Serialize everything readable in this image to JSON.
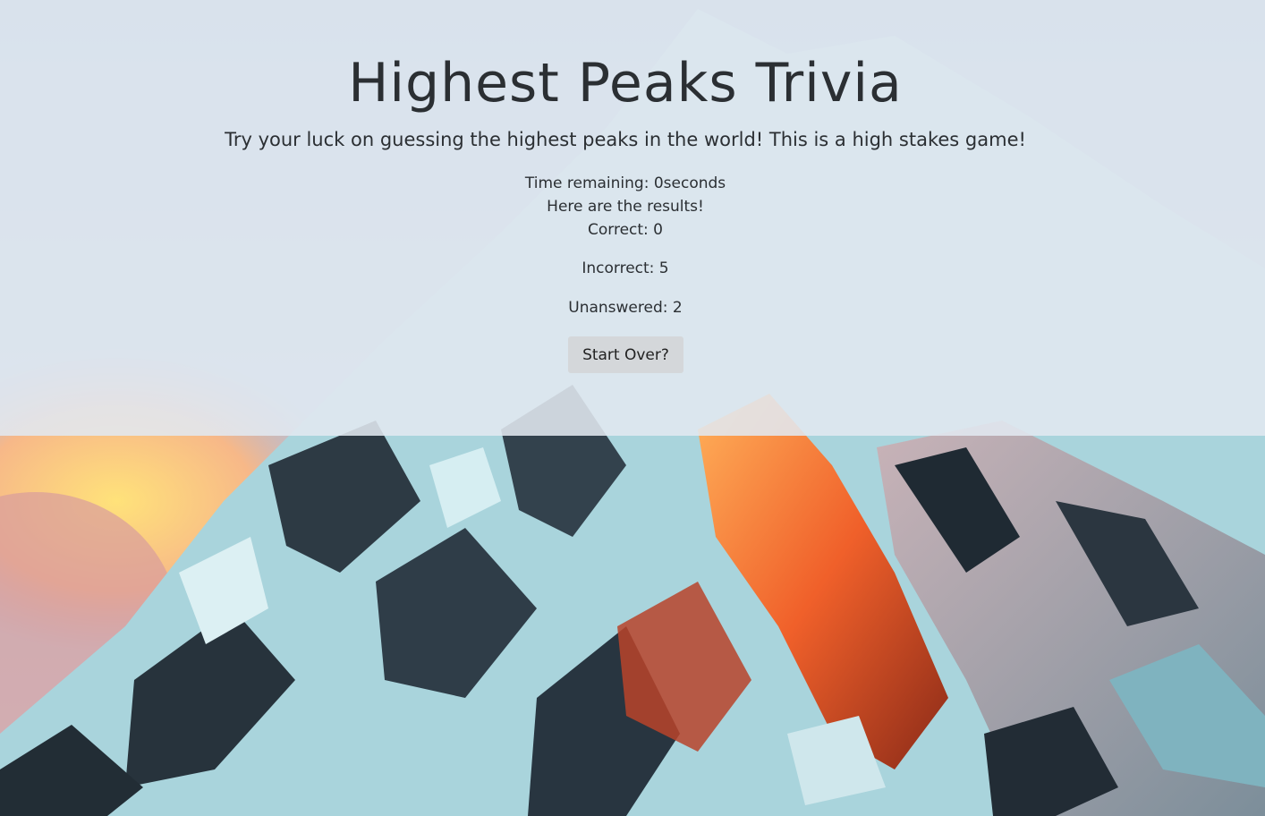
{
  "header": {
    "title": "Highest Peaks Trivia",
    "subtitle": "Try your luck on guessing the highest peaks in the world! This is a high stakes game!"
  },
  "results": {
    "time_remaining": "Time remaining: 0seconds",
    "results_heading": "Here are the results!",
    "correct": "Correct: 0",
    "incorrect": "Incorrect: 5",
    "unanswered": "Unanswered: 2"
  },
  "actions": {
    "start_over_label": "Start Over?"
  },
  "colors": {
    "overlay": "#e1e8f0",
    "button_bg": "#d4d7da",
    "text": "#2b2f33"
  }
}
